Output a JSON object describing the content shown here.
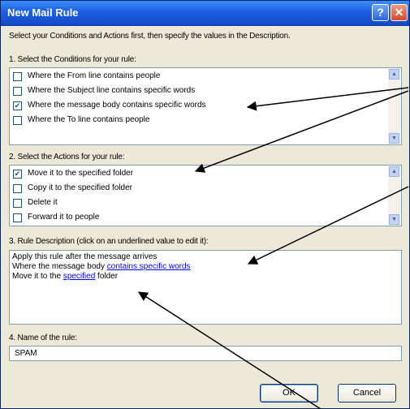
{
  "window": {
    "title": "New Mail Rule",
    "help_label": "?",
    "close_label": "✕"
  },
  "intro": "Select your Conditions and Actions first, then specify the values in the Description.",
  "conditions": {
    "label": "1. Select the Conditions for your rule:",
    "items": [
      {
        "label": "Where the From line contains people",
        "checked": false
      },
      {
        "label": "Where the Subject line contains specific words",
        "checked": false
      },
      {
        "label": "Where the message body contains specific words",
        "checked": true
      },
      {
        "label": "Where the To line contains people",
        "checked": false
      }
    ]
  },
  "actions": {
    "label": "2. Select the Actions for your rule:",
    "items": [
      {
        "label": "Move it to the specified folder",
        "checked": true
      },
      {
        "label": "Copy it to the specified folder",
        "checked": false
      },
      {
        "label": "Delete it",
        "checked": false
      },
      {
        "label": "Forward it to people",
        "checked": false
      }
    ]
  },
  "description": {
    "label": "3. Rule Description (click on an underlined value to edit it):",
    "line1": "Apply this rule after the message arrives",
    "line2_prefix": "Where the message body ",
    "line2_link": "contains specific words",
    "line3_prefix": "Move it to the ",
    "line3_link": "specified",
    "line3_suffix": " folder"
  },
  "name_field": {
    "label": "4. Name of the rule:",
    "value": "SPAM"
  },
  "buttons": {
    "ok": "OK",
    "cancel": "Cancel"
  },
  "scrollbar": {
    "up": "▲",
    "down": "▼"
  },
  "check_mark": "✔"
}
